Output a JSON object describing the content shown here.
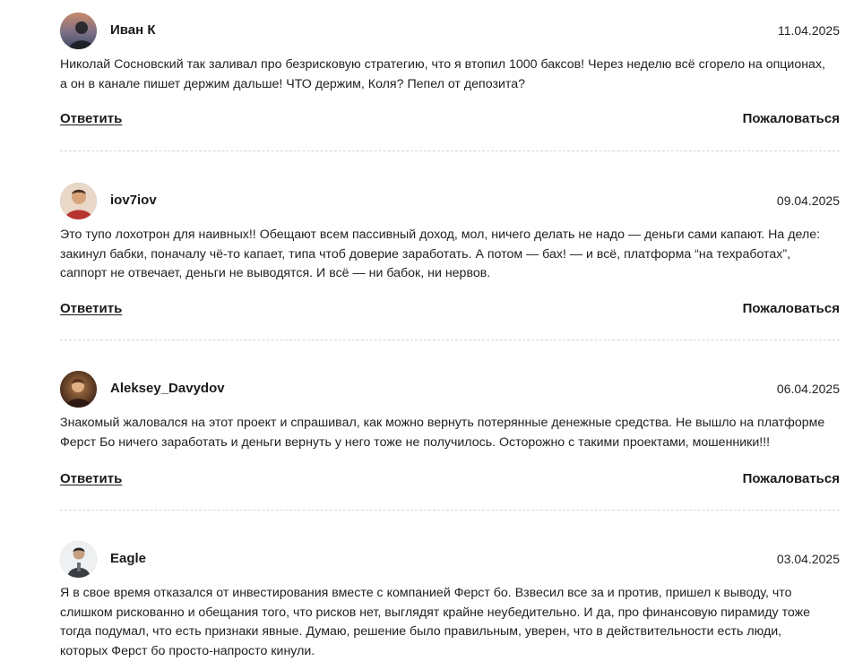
{
  "actions": {
    "reply_label": "Ответить",
    "report_label": "Пожаловаться"
  },
  "comments": [
    {
      "author": "Иван К",
      "date": "11.04.2025",
      "text": "Николай Сосновский так заливал про безрисковую стратегию, что я втопил 1000 баксов! Через неделю всё сгорело на опционах, а он в канале пишет держим дальше! ЧТО держим, Коля? Пепел от депозита?"
    },
    {
      "author": "iov7iov",
      "date": "09.04.2025",
      "text": "Это тупо лохотрон для наивных!! Обещают всем пассивный доход, мол, ничего делать не надо — деньги сами капают. На деле: закинул бабки, поначалу чё-то капает, типа чтоб доверие заработать. А потом — бах! — и всё, платформа “на техработах”, саппорт не отвечает, деньги не выводятся. И всё — ни бабок, ни нервов."
    },
    {
      "author": "Aleksey_Davydov",
      "date": "06.04.2025",
      "text": "Знакомый жаловался на этот проект и спрашивал, как можно вернуть потерянные денежные средства. Не вышло на платформе Ферст Бо ничего заработать и деньги вернуть у него тоже не получилось. Осторожно с такими проектами, мошенники!!!"
    },
    {
      "author": "Eagle",
      "date": "03.04.2025",
      "text": "Я в свое время отказался от инвестирования вместе с компанией Ферст бо. Взвесил все за и против, пришел к выводу, что слишком рискованно и обещания того, что рисков нет, выглядят крайне неубедительно. И да, про финансовую пирамиду тоже тогда подумал, что есть признаки явные. Думаю, решение было правильным, уверен, что в действительности есть люди, которых Ферст бо просто-напросто кинули."
    }
  ]
}
